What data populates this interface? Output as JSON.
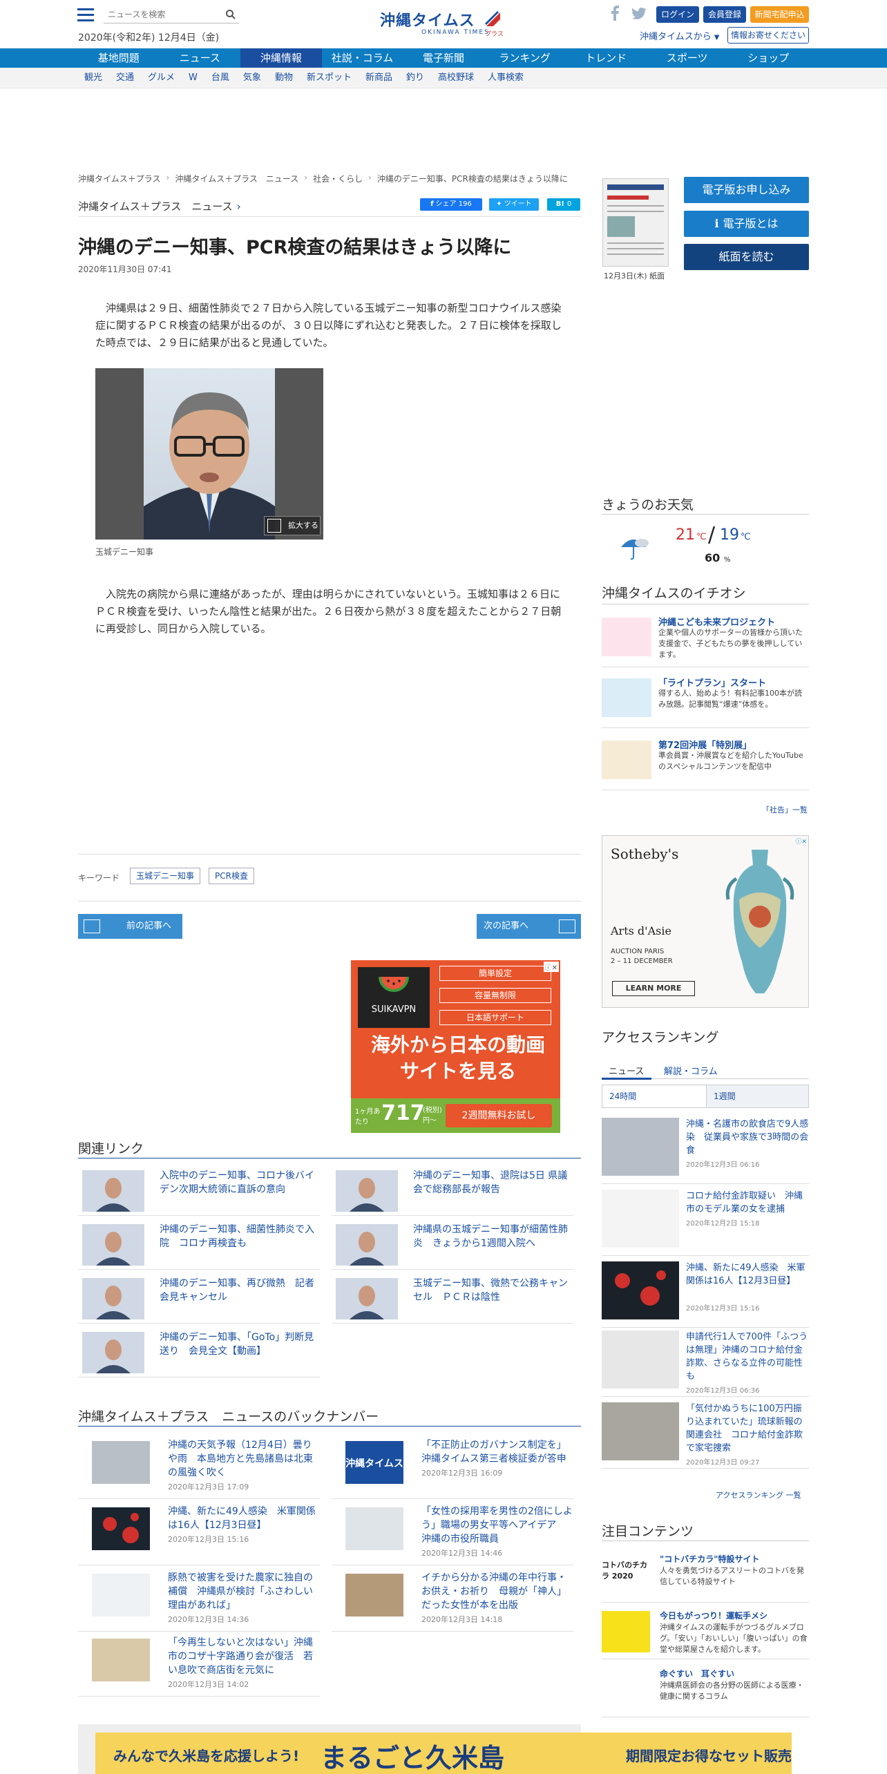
{
  "header": {
    "search_placeholder": "ニュースを検索",
    "date": "2020年(令和2年) 12月4日（金)",
    "logo_main": "沖縄タイムス",
    "logo_plus": "プラス",
    "logo_sub": "OKINAWA TIMES",
    "login": "ログイン",
    "register": "会員登録",
    "subscribe": "新聞宅配申込",
    "from_times": "沖縄タイムスから",
    "send_info": "情報お寄せください"
  },
  "nav": [
    "基地問題",
    "ニュース",
    "沖縄情報",
    "社説・コラム",
    "電子新聞",
    "ランキング",
    "トレンド",
    "スポーツ",
    "ショップ"
  ],
  "nav_active": "沖縄情報",
  "subnav": [
    "観光",
    "交通",
    "グルメ",
    "W",
    "台風",
    "気象",
    "動物",
    "新スポット",
    "新商品",
    "釣り",
    "高校野球",
    "人事検索"
  ],
  "breadcrumb": [
    "沖縄タイムス＋プラス",
    "沖縄タイムス＋プラス　ニュース",
    "社会・くらし",
    "沖縄のデニー知事、PCR検査の結果はきょう以降に"
  ],
  "article": {
    "section": "沖縄タイムス＋プラス　ニュース",
    "share_fb": "シェア 196",
    "share_tw": "ツイート",
    "share_hb": "0",
    "title": "沖縄のデニー知事、PCR検査の結果はきょう以降に",
    "date": "2020年11月30日 07:41",
    "para1": "沖縄県は２９日、細菌性肺炎で２７日から入院している玉城デニー知事の新型コロナウイルス感染症に関するＰＣＲ検査の結果が出るのが、３０日以降にずれ込むと発表した。２７日に検体を採取した時点では、２９日に結果が出ると見通していた。",
    "zoom": "拡大する",
    "caption": "玉城デニー知事",
    "para2": "入院先の病院から県に連絡があったが、理由は明らかにされていないという。玉城知事は２６日にＰＣＲ検査を受け、いったん陰性と結果が出た。２６日夜から熱が３８度を超えたことから２７日朝に再受診し、同日から入院している。",
    "keyword_label": "キーワード",
    "keywords": [
      "玉城デニー知事",
      "PCR検査"
    ],
    "prev": "前の記事へ",
    "next": "次の記事へ"
  },
  "ad_vpn": {
    "brand": "SUIKAVPN",
    "pills": [
      "簡単設定",
      "容量無制限",
      "日本語サポート"
    ],
    "headline": "海外から日本の動画サイトを見る",
    "price_label": "1ヶ月あたり",
    "price": "717",
    "price_suffix": "(税別)円〜",
    "cta": "2週間無料お試し"
  },
  "related": {
    "heading": "関連リンク",
    "items": [
      "入院中のデニー知事、コロナ後バイデン次期大統領に直訴の意向",
      "沖縄のデニー知事、退院は5日 県議会で総務部長が報告",
      "沖縄のデニー知事、細菌性肺炎で入院　コロナ再検査も",
      "沖縄県の玉城デニー知事が細菌性肺炎　きょうから1週間入院へ",
      "沖縄のデニー知事、再び微熱　記者会見キャンセル",
      "玉城デニー知事、微熱で公務キャンセル　ＰＣＲは陰性",
      "沖縄のデニー知事、「GoTo」判断見送り　会見全文【動画】"
    ]
  },
  "backnumber": {
    "heading": "沖縄タイムス＋プラス　ニュースのバックナンバー",
    "items": [
      {
        "title": "沖縄の天気予報（12月4日）曇りや雨　本島地方と先島諸島は北東の風強く吹く",
        "date": "2020年12月3日 17:09"
      },
      {
        "title": "「不正防止のガバナンス制定を」沖縄タイムス第三者検証委が答申",
        "date": "2020年12月3日 16:09"
      },
      {
        "title": "沖縄、新たに49人感染　米軍関係は16人【12月3日昼】",
        "date": "2020年12月3日 15:16"
      },
      {
        "title": "「女性の採用率を男性の2倍にしよう」職場の男女平等へアイデア　沖縄の市役所職員",
        "date": "2020年12月3日 14:46"
      },
      {
        "title": "豚熱で被害を受けた農家に独自の補償　沖縄県が検討「ふさわしい理由があれば」",
        "date": "2020年12月3日 14:36"
      },
      {
        "title": "イチから分かる沖縄の年中行事・お供え・お祈り　母親が「神人」だった女性が本を出版",
        "date": "2020年12月3日 14:18"
      },
      {
        "title": "「今再生しないと次はない」沖縄市のコザ十字路通り会が復活　若い息吹で商店街を元気に",
        "date": "2020年12月3日 14:02"
      }
    ],
    "logo_text": "沖縄タイムス"
  },
  "sidebar": {
    "paper_caption": "12月3日(木) 紙面",
    "btn_apply": "電子版お申し込み",
    "btn_about": "電子版とは",
    "btn_read": "紙面を読む",
    "weather_heading": "きょうのお天気",
    "weather_hi": "21",
    "weather_lo": "19",
    "temp_unit": "℃",
    "weather_pct": "60",
    "pct_unit": "%",
    "ichioshi_heading": "沖縄タイムスのイチオシ",
    "ichioshi": [
      {
        "title": "沖縄こども未来プロジェクト",
        "text": "企業や個人のサポーターの皆様から頂いた支援金で、子どもたちの夢を後押ししています。"
      },
      {
        "title": "「ライトプラン」スタート",
        "text": "得する人、始めよう！有料記事100本が読み放題。記事閲覧“爆速”体感を。"
      },
      {
        "title": "第72回沖展「特別展」",
        "text": "準会員賞・沖展賞などを紹介したYouTubeのスペシャルコンテンツを配信中"
      }
    ],
    "shasetsu_link": "「社告」一覧",
    "ad_sothebys": {
      "brand": "Sotheby's",
      "sub": "Arts d'Asie",
      "place": "AUCTION PARIS",
      "dates": "2 – 11 DECEMBER",
      "cta": "LEARN MORE"
    },
    "ranking_heading": "アクセスランキング",
    "ranking_tabs": [
      "ニュース",
      "解説・コラム"
    ],
    "ranking_subtabs": [
      "24時間",
      "1週間"
    ],
    "ranking": [
      {
        "title": "沖縄・名護市の飲食店で9人感染　従業員や家族で3時間の会食",
        "date": "2020年12月3日 06:16"
      },
      {
        "title": "コロナ給付金詐取疑い　沖縄市のモデル業の女を逮捕",
        "date": "2020年12月2日 15:18"
      },
      {
        "title": "沖縄、新たに49人感染　米軍関係は16人【12月3日昼】",
        "date": "2020年12月3日 15:16"
      },
      {
        "title": "申請代行1人で700件「ふつうは無理」沖縄のコロナ給付金詐欺、さらなる立件の可能性も",
        "date": "2020年12月3日 06:36"
      },
      {
        "title": "「気付かぬうちに100万円振り込まれていた」琉球新報の関連会社　コロナ給付金詐欺で家宅捜索",
        "date": "2020年12月3日 09:27"
      }
    ],
    "ranking_more": "アクセスランキング 一覧",
    "chumoku_heading": "注目コンテンツ",
    "chumoku": [
      {
        "title": "\"コトバチカラ\"特設サイト",
        "text": "人々を勇気づけるアスリートのコトバを発信している特設サイト"
      },
      {
        "title": "今日もがっつり！運転手メシ",
        "text": "沖縄タイムスの運転手がつづるグルメブログ。「安い」「おいしい」「腹いっぱい」の食堂や総菜屋さんを紹介します。"
      },
      {
        "title": "命ぐすい　耳ぐすい",
        "text": "沖縄県医師会の各分野の医師による医療・健康に関するコラム"
      }
    ],
    "chumoku_thumb1": "コトバのチカラ 2020"
  },
  "banner": {
    "left": "みんなで久米島を応援しよう!",
    "center": "まるごと久米島",
    "right": "期間限定お得なセット販売"
  }
}
